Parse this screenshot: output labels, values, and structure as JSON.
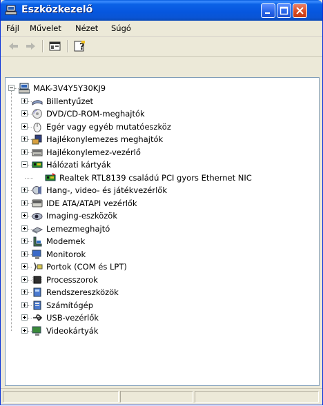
{
  "window": {
    "title": "Eszközkezelő",
    "accent": "#0a55d4"
  },
  "menu": {
    "items": [
      "Fájl",
      "Művelet",
      "Nézet",
      "Súgó"
    ]
  },
  "tree": {
    "root": "MAK-3V4Y5Y30KJ9",
    "categories": [
      {
        "label": "Billentyűzet",
        "icon": "keyboard-icon"
      },
      {
        "label": "DVD/CD-ROM-meghajtók",
        "icon": "cd-drive-icon"
      },
      {
        "label": "Egér vagy egyéb mutatóeszköz",
        "icon": "mouse-icon"
      },
      {
        "label": "Hajlékonylemezes meghajtók",
        "icon": "floppy-drive-icon"
      },
      {
        "label": "Hajlékonylemez-vezérlő",
        "icon": "floppy-controller-icon"
      },
      {
        "label": "Hálózati kártyák",
        "icon": "network-card-icon",
        "expanded": true,
        "children": [
          "Realtek RTL8139 családú PCI gyors Ethernet NIC"
        ]
      },
      {
        "label": "Hang-, video- és játékvezérlők",
        "icon": "sound-icon"
      },
      {
        "label": "IDE ATA/ATAPI vezérlők",
        "icon": "ide-controller-icon"
      },
      {
        "label": "Imaging-eszközök",
        "icon": "camera-icon"
      },
      {
        "label": "Lemezmeghajtó",
        "icon": "disk-drive-icon"
      },
      {
        "label": "Modemek",
        "icon": "modem-icon"
      },
      {
        "label": "Monitorok",
        "icon": "monitor-icon"
      },
      {
        "label": "Portok (COM és LPT)",
        "icon": "port-icon"
      },
      {
        "label": "Processzorok",
        "icon": "processor-icon"
      },
      {
        "label": "Rendszereszközök",
        "icon": "system-device-icon"
      },
      {
        "label": "Számítógép",
        "icon": "computer-icon"
      },
      {
        "label": "USB-vezérlők",
        "icon": "usb-icon"
      },
      {
        "label": "Videokártyák",
        "icon": "display-adapter-icon"
      }
    ]
  }
}
